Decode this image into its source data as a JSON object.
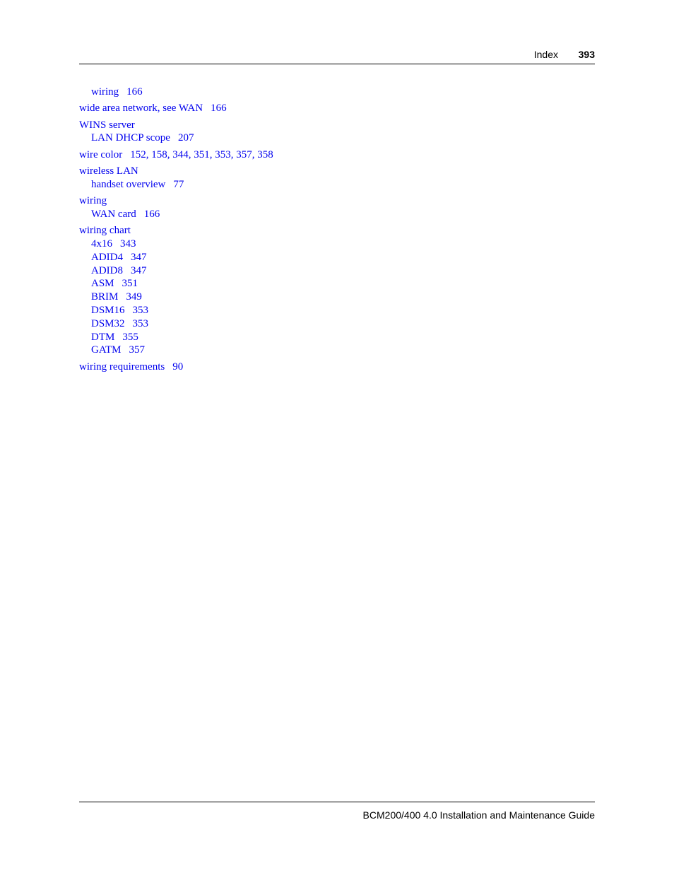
{
  "header": {
    "section": "Index",
    "page_number": "393"
  },
  "index_entries": [
    {
      "level": "sub",
      "term": "wiring",
      "pages": "166"
    },
    {
      "level": "main",
      "term": "wide area network, see WAN",
      "pages": "166"
    },
    {
      "level": "main",
      "term": "WINS server",
      "pages": ""
    },
    {
      "level": "sub",
      "term": "LAN DHCP scope",
      "pages": "207"
    },
    {
      "level": "main",
      "term": "wire color",
      "pages": "152, 158, 344, 351, 353, 357, 358"
    },
    {
      "level": "main",
      "term": "wireless LAN",
      "pages": ""
    },
    {
      "level": "sub",
      "term": "handset overview",
      "pages": "77"
    },
    {
      "level": "main",
      "term": "wiring",
      "pages": ""
    },
    {
      "level": "sub",
      "term": "WAN card",
      "pages": "166"
    },
    {
      "level": "main",
      "term": "wiring chart",
      "pages": ""
    },
    {
      "level": "sub",
      "term": "4x16",
      "pages": "343"
    },
    {
      "level": "sub",
      "term": "ADID4",
      "pages": "347"
    },
    {
      "level": "sub",
      "term": "ADID8",
      "pages": "347"
    },
    {
      "level": "sub",
      "term": "ASM",
      "pages": "351"
    },
    {
      "level": "sub",
      "term": "BRIM",
      "pages": "349"
    },
    {
      "level": "sub",
      "term": "DSM16",
      "pages": "353"
    },
    {
      "level": "sub",
      "term": "DSM32",
      "pages": "353"
    },
    {
      "level": "sub",
      "term": "DTM",
      "pages": "355"
    },
    {
      "level": "sub",
      "term": "GATM",
      "pages": "357"
    },
    {
      "level": "main",
      "term": "wiring requirements",
      "pages": "90"
    }
  ],
  "footer": {
    "title": "BCM200/400 4.0 Installation and Maintenance Guide"
  },
  "colors": {
    "link": "#0000ee",
    "text": "#000000"
  }
}
